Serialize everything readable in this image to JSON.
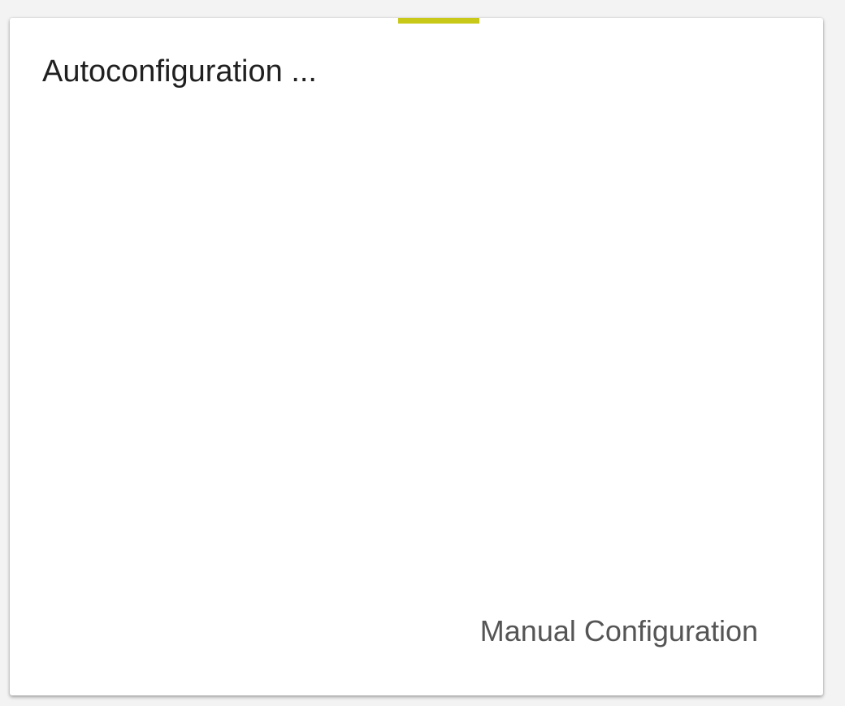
{
  "dialog": {
    "title": "Autoconfiguration ...",
    "progress_color": "#c8c818",
    "manual_config_label": "Manual Configuration"
  }
}
